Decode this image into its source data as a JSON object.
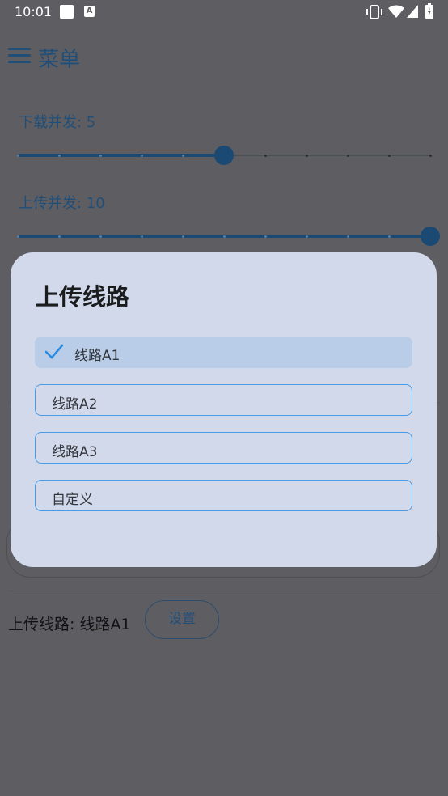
{
  "status_bar": {
    "time": "10:01",
    "badge_letter": "A"
  },
  "header": {
    "title": "菜单",
    "menu_icon": "hamburger-menu-icon"
  },
  "sliders": [
    {
      "label": "下载并发: 5",
      "value": 5,
      "max": 10
    },
    {
      "label": "上传并发: 10",
      "value": 10,
      "max": 10
    }
  ],
  "upload_route_row": {
    "text": "上传线路: 线路A1",
    "set_button": "设置"
  },
  "dialog": {
    "title": "上传线路",
    "options": [
      {
        "label": "线路A1",
        "selected": true
      },
      {
        "label": "线路A2",
        "selected": false
      },
      {
        "label": "线路A3",
        "selected": false
      },
      {
        "label": "自定义",
        "selected": false
      }
    ]
  },
  "colors": {
    "scrim": "#5e5d62",
    "dialog_bg": "#d2d9ea",
    "selected_option_bg": "#b9cde8",
    "option_border": "#4a9be6",
    "accent": "#1f4e79"
  }
}
